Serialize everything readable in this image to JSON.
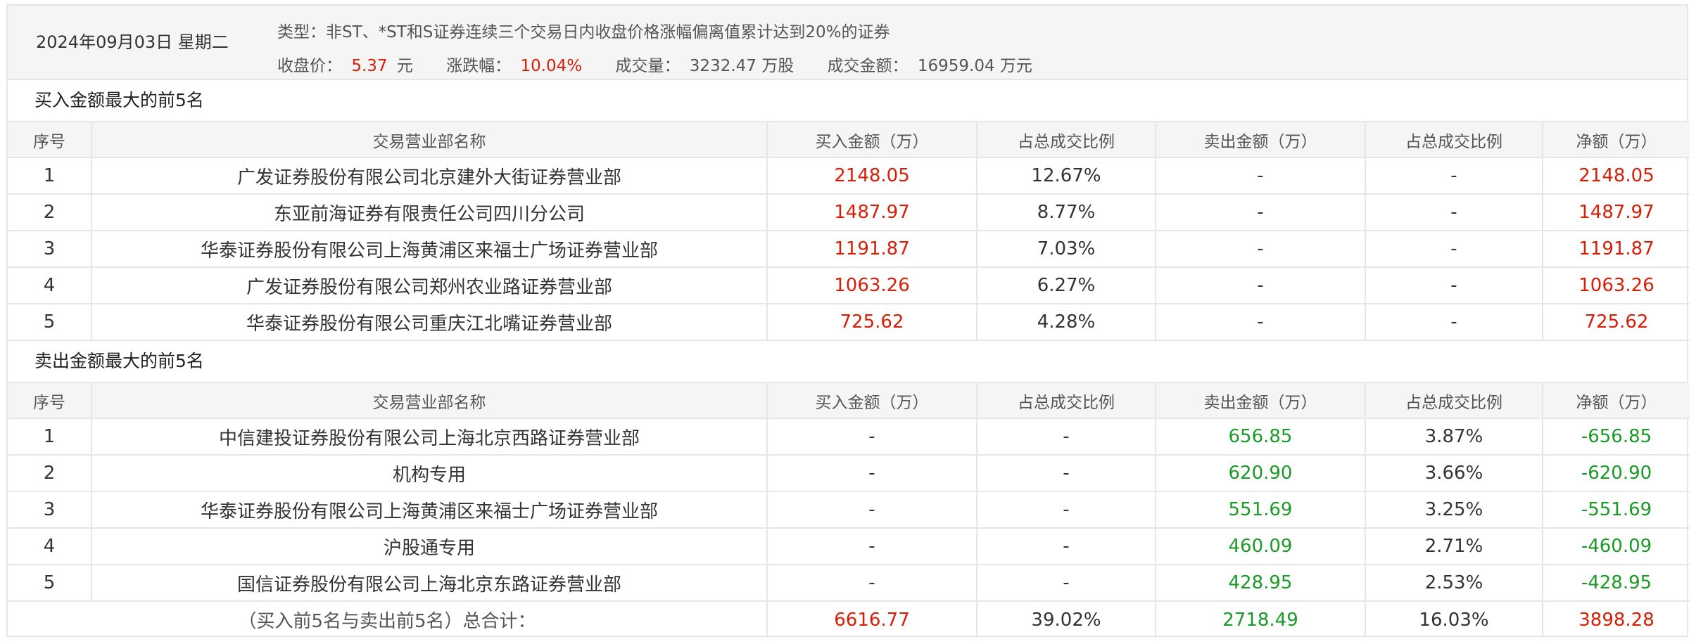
{
  "header": {
    "date": "2024年09月03日 星期二",
    "type_label": "类型：",
    "type_value": "非ST、*ST和S证券连续三个交易日内收盘价格涨幅偏离值累计达到20%的证券",
    "close_label": "收盘价：",
    "close_value": "5.37",
    "close_unit": "元",
    "change_label": "涨跌幅：",
    "change_value": "10.04%",
    "volume_label": "成交量：",
    "volume_value": "3232.47 万股",
    "amount_label": "成交金额：",
    "amount_value": "16959.04 万元"
  },
  "columns": [
    "序号",
    "交易营业部名称",
    "买入金额（万）",
    "占总成交比例",
    "卖出金额（万）",
    "占总成交比例",
    "净额（万）"
  ],
  "buy_section": {
    "title": "买入金额最大的前5名",
    "rows": [
      {
        "rank": "1",
        "name": "广发证券股份有限公司北京建外大街证券营业部",
        "buy": "2148.05",
        "buy_pct": "12.67%",
        "sell": "-",
        "sell_pct": "-",
        "net": "2148.05"
      },
      {
        "rank": "2",
        "name": "东亚前海证券有限责任公司四川分公司",
        "buy": "1487.97",
        "buy_pct": "8.77%",
        "sell": "-",
        "sell_pct": "-",
        "net": "1487.97"
      },
      {
        "rank": "3",
        "name": "华泰证券股份有限公司上海黄浦区来福士广场证券营业部",
        "buy": "1191.87",
        "buy_pct": "7.03%",
        "sell": "-",
        "sell_pct": "-",
        "net": "1191.87"
      },
      {
        "rank": "4",
        "name": "广发证券股份有限公司郑州农业路证券营业部",
        "buy": "1063.26",
        "buy_pct": "6.27%",
        "sell": "-",
        "sell_pct": "-",
        "net": "1063.26"
      },
      {
        "rank": "5",
        "name": "华泰证券股份有限公司重庆江北嘴证券营业部",
        "buy": "725.62",
        "buy_pct": "4.28%",
        "sell": "-",
        "sell_pct": "-",
        "net": "725.62"
      }
    ]
  },
  "sell_section": {
    "title": "卖出金额最大的前5名",
    "rows": [
      {
        "rank": "1",
        "name": "中信建投证券股份有限公司上海北京西路证券营业部",
        "buy": "-",
        "buy_pct": "-",
        "sell": "656.85",
        "sell_pct": "3.87%",
        "net": "-656.85"
      },
      {
        "rank": "2",
        "name": "机构专用",
        "buy": "-",
        "buy_pct": "-",
        "sell": "620.90",
        "sell_pct": "3.66%",
        "net": "-620.90"
      },
      {
        "rank": "3",
        "name": "华泰证券股份有限公司上海黄浦区来福士广场证券营业部",
        "buy": "-",
        "buy_pct": "-",
        "sell": "551.69",
        "sell_pct": "3.25%",
        "net": "-551.69"
      },
      {
        "rank": "4",
        "name": "沪股通专用",
        "buy": "-",
        "buy_pct": "-",
        "sell": "460.09",
        "sell_pct": "2.71%",
        "net": "-460.09"
      },
      {
        "rank": "5",
        "name": "国信证券股份有限公司上海北京东路证券营业部",
        "buy": "-",
        "buy_pct": "-",
        "sell": "428.95",
        "sell_pct": "2.53%",
        "net": "-428.95"
      }
    ]
  },
  "total": {
    "label": "（买入前5名与卖出前5名）总合计：",
    "buy": "6616.77",
    "buy_pct": "39.02%",
    "sell": "2718.49",
    "sell_pct": "16.03%",
    "net": "3898.28"
  },
  "colors": {
    "positive": "#d81e06",
    "negative": "#1a9a26"
  }
}
